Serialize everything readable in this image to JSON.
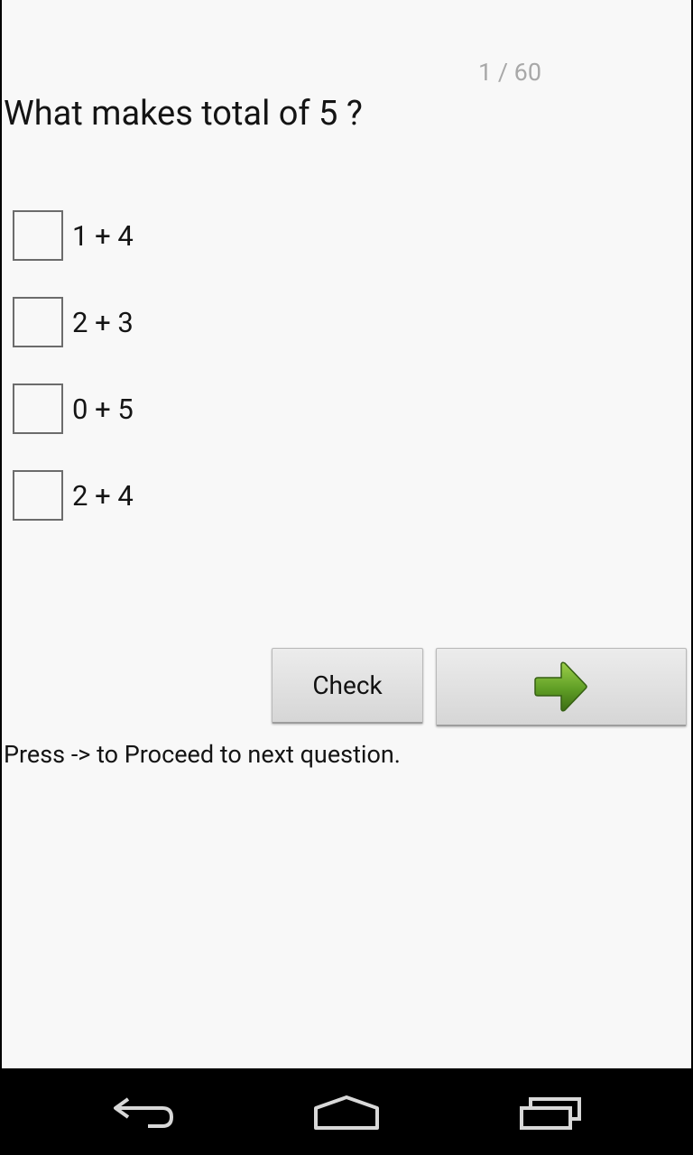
{
  "progress": {
    "counter": "1 / 60"
  },
  "question": {
    "text": "What makes total of 5 ?"
  },
  "options": [
    {
      "label": "1 + 4",
      "checked": false
    },
    {
      "label": "2 + 3",
      "checked": false
    },
    {
      "label": "0 + 5",
      "checked": false
    },
    {
      "label": "2 + 4",
      "checked": false
    }
  ],
  "buttons": {
    "check_label": "Check",
    "next_icon": "arrow-right-icon"
  },
  "hint": {
    "text": "Press -> to Proceed to next question."
  },
  "navbar": {
    "back_icon": "back-icon",
    "home_icon": "home-icon",
    "recents_icon": "recents-icon"
  },
  "colors": {
    "arrow_green": "#5f9e25",
    "background": "#f8f8f8"
  }
}
